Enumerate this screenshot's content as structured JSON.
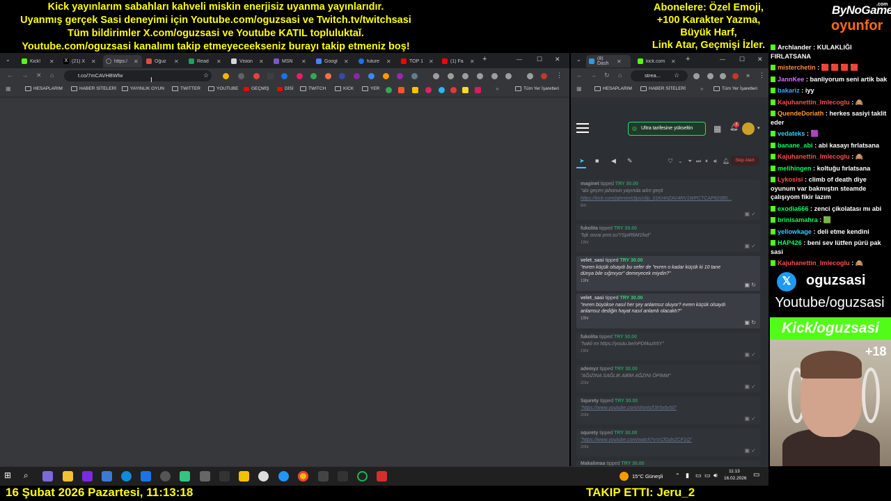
{
  "overlay": {
    "center_lines": [
      "Kick yayınlarım sabahları kahveli miskin enerjisiz uyanma yayınlarıdır.",
      "Uyanmış gerçek Sasi deneyimi için Youtube.com/oguzsasi ve Twitch.tv/twitchsasi",
      "Tüm bildirimler X.com/oguzsasi ve Youtube KATIL topluluktaǐ.",
      "Youtube.com/oguzsasi kanalımı takip etmeyeceekseniz burayı takip etmeniz boş!"
    ],
    "right_lines": [
      "Abonelere: Özel Emoji,",
      "+100 Karakter Yazma,",
      "Büyük Harf,",
      "Link Atar, Geçmişi İzler."
    ],
    "logo_top": "ByNoGame",
    "logo_com": ".com",
    "logo_bottom": "oyunfor",
    "social_name": "oguzsasi",
    "youtube_text": "Youtube/oguzsasi",
    "kick_text": "Kick/oguzsasi",
    "age_badge": "+18",
    "datetime": "16 Şubat 2026 Pazartesi, 11:13:18",
    "follow": "TAKIP ETTI: Jeru_2",
    "colors": {
      "yellow": "#ffff00",
      "kick_green": "#53fc18",
      "name_green": "#00ff66",
      "twitter_blue": "#1d9bf0"
    }
  },
  "left_browser": {
    "tabs": [
      "Kick!",
      "(21) X",
      "https:/",
      "Oğuz",
      "Read",
      "Vision",
      "MSN",
      "Googl",
      "future",
      "TOP 1",
      "(1) Fa"
    ],
    "url": "t.co/7mCAVHBWfw",
    "bookmarks": [
      "HESAPLARIM",
      "HABER SİTELERİ",
      "YAYINLIK OYUN",
      "TWITTER",
      "YOUTUBE",
      "GEÇMİŞ",
      "DİSİ",
      "TWITCH",
      "KICK",
      "YER"
    ],
    "all_bookmarks": "Tüm Yer İşaretleri"
  },
  "right_browser": {
    "tabs": [
      "(8) Dash",
      "kick.com"
    ],
    "url": "strea...",
    "bookmarks": [
      "HESAPLARIM",
      "HABER SİTELERİ"
    ],
    "all_bookmarks": "Tüm Yer İşaretleri",
    "upgrade": "Ultra tarifesine yükseltin",
    "skip": "Skip Alert",
    "notif_count": "2",
    "tipped_word": "tipped",
    "tips": [
      {
        "user": "maginet",
        "amount": "TRY 30.00",
        "msg": "\"abi geçen jahonun yayında adın geçti",
        "link": "https://kick.com/jahrein/clips/clip_01KHHZAV4RV1WPCTCAP92085...",
        "age": "8m",
        "dim": true
      },
      {
        "user": "fukolita",
        "amount": "TRY 30.00",
        "msg": "\"bjk sezai prnt.sc/YSpIRbM1fod\"",
        "age": "19hr",
        "dim": true
      },
      {
        "user": "velet_sasi",
        "amount": "TRY 30.00",
        "msg": "\"evren küçük olsaydı bu sefer de \"evren o kadar küçük ki 10 tane dünya bile sığmıyor\" demeyecek miydin?\"",
        "age": "19hr",
        "dim": false
      },
      {
        "user": "velet_sasi",
        "amount": "TRY 30.00",
        "msg": "\"evren büyükse nasıl her şey anlamsız oluyor? evren küçük olsaydı anlamsız dediğin hayat nasıl anlamlı olacaktı?\"",
        "age": "19hr",
        "dim": false
      },
      {
        "user": "fukolita",
        "amount": "TRY 30.00",
        "msg": "\"hakli mi https://youtu.be/nPDf4uzh5Y\"",
        "age": "19hr",
        "dim": true
      },
      {
        "user": "ademyz",
        "amount": "TRY 30.00",
        "msg": "\"AĞIZINA SAĞLIK ABİM AĞZINI ÖPİMM\"",
        "age": "20hr",
        "dim": true
      },
      {
        "user": "Squrety",
        "amount": "TRY 30.00",
        "msg": "\"https://www.youtube.com/shorts/fJIr5x6x50\"",
        "age": "20hr",
        "dim": true
      },
      {
        "user": "squrety",
        "amount": "TRY 30.00",
        "msg": "\"https://www.youtube.com/watch?v=rCfGdnZCF1Q\"",
        "age": "20hr",
        "dim": true
      },
      {
        "user": "Makalimaa",
        "amount": "TRY 30.00",
        "msg": "",
        "age": "",
        "dim": true
      }
    ]
  },
  "chat": [
    {
      "user": "Archlander",
      "text": "KULAKLIĞI FIRLATSANA",
      "color": "#ffffff"
    },
    {
      "user": "misterchetin",
      "text": "🟥 🟥 🟥 🟥",
      "color": "#ff8844"
    },
    {
      "user": "JannKee",
      "text": "banliyorum seni artik bak",
      "color": "#d96bff"
    },
    {
      "user": "bakariz",
      "text": "iyy",
      "color": "#33aaff"
    },
    {
      "user": "Kajuhanettin_Imlecoglu",
      "text": "🙈",
      "color": "#ff4b4b"
    },
    {
      "user": "QuendeDoriath",
      "text": "herkes sasiyi taklit eder",
      "color": "#ff9933"
    },
    {
      "user": "vedateks",
      "text": "🟪",
      "color": "#33ccff"
    },
    {
      "user": "banane_abi",
      "text": "abi kasayı fırlatsana",
      "color": "#00ff66"
    },
    {
      "user": "Kajuhanettin_Imlecoglu",
      "text": "🙈",
      "color": "#ff4b4b"
    },
    {
      "user": "melihingen",
      "text": "koltuğu fırlatsana",
      "color": "#00ff66"
    },
    {
      "user": "Lykosisi",
      "text": "climb of death diye oyunum var bakmıştın steamde çalışıyom fikir lazım",
      "color": "#ff4b4b"
    },
    {
      "user": "exodia666",
      "text": "zenci çikolatası mı abi",
      "color": "#00ff66"
    },
    {
      "user": "brinisamahra",
      "text": "🟩",
      "color": "#00ff66"
    },
    {
      "user": "yellowkage",
      "text": "deli etme kendini",
      "color": "#33ccff"
    },
    {
      "user": "HAP426",
      "text": "beni sev lütfen pürü pak sasi",
      "color": "#00ff66"
    },
    {
      "user": "Kajuhanettin_Imlecoglu",
      "text": "🙈",
      "color": "#ff4b4b"
    }
  ],
  "taskbar": {
    "weather": "15°C Güneşli",
    "time": "11:13",
    "date": "16.02.2026"
  }
}
